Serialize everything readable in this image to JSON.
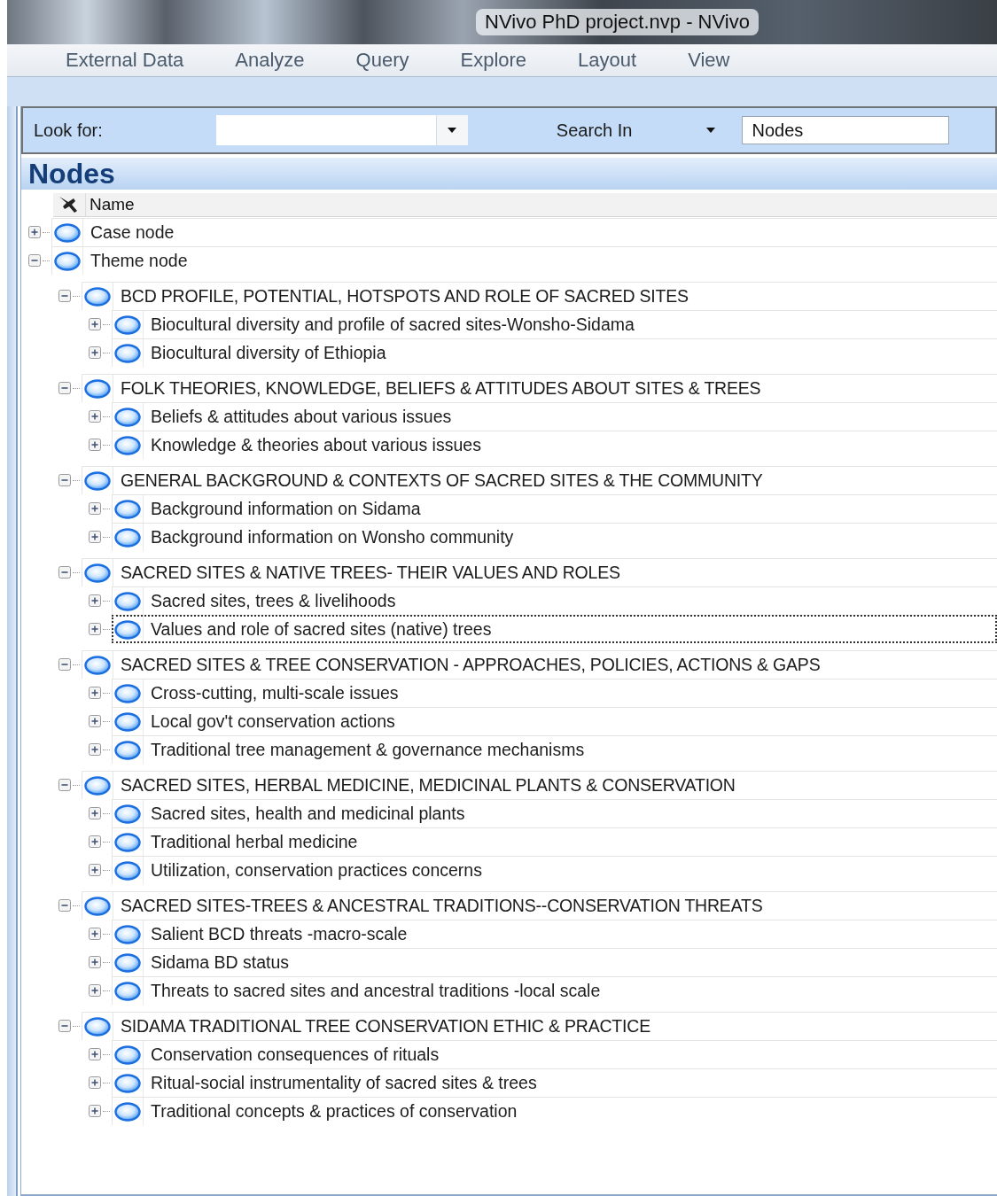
{
  "window": {
    "title": "NVivo PhD project.nvp - NVivo"
  },
  "menu": [
    {
      "label": "External Data"
    },
    {
      "label": "Analyze"
    },
    {
      "label": "Query"
    },
    {
      "label": "Explore"
    },
    {
      "label": "Layout"
    },
    {
      "label": "View"
    }
  ],
  "search": {
    "look_for_label": "Look for:",
    "search_in_label": "Search In",
    "scope": "Nodes"
  },
  "panel": {
    "title": "Nodes"
  },
  "columns": [
    "Name"
  ],
  "nodes": [
    {
      "name": "Case node",
      "expanded": false,
      "selected": false
    },
    {
      "name": "Theme node",
      "expanded": true,
      "selected": false,
      "children": [
        {
          "name": "BCD PROFILE, POTENTIAL, HOTSPOTS AND ROLE OF SACRED SITES",
          "expanded": true,
          "selected": false,
          "children": [
            {
              "name": "Biocultural diversity and profile of sacred sites-Wonsho-Sidama",
              "expanded": false,
              "selected": false
            },
            {
              "name": "Biocultural diversity of Ethiopia",
              "expanded": false,
              "selected": false
            }
          ]
        },
        {
          "name": "FOLK THEORIES, KNOWLEDGE, BELIEFS & ATTITUDES ABOUT SITES & TREES",
          "expanded": true,
          "selected": false,
          "children": [
            {
              "name": "Beliefs & attitudes about various issues",
              "expanded": false,
              "selected": false
            },
            {
              "name": "Knowledge & theories about various issues",
              "expanded": false,
              "selected": false
            }
          ]
        },
        {
          "name": "GENERAL BACKGROUND & CONTEXTS OF SACRED SITES & THE COMMUNITY",
          "expanded": true,
          "selected": false,
          "children": [
            {
              "name": "Background information on Sidama",
              "expanded": false,
              "selected": false
            },
            {
              "name": "Background information on Wonsho community",
              "expanded": false,
              "selected": false
            }
          ]
        },
        {
          "name": "SACRED SITES & NATIVE TREES- THEIR VALUES AND ROLES",
          "expanded": true,
          "selected": false,
          "children": [
            {
              "name": "Sacred sites, trees & livelihoods",
              "expanded": false,
              "selected": false
            },
            {
              "name": "Values and role of sacred sites (native) trees",
              "expanded": false,
              "selected": true
            }
          ]
        },
        {
          "name": "SACRED SITES & TREE CONSERVATION - APPROACHES, POLICIES, ACTIONS & GAPS",
          "expanded": true,
          "selected": false,
          "children": [
            {
              "name": "Cross-cutting, multi-scale issues",
              "expanded": false,
              "selected": false
            },
            {
              "name": "Local gov't conservation actions",
              "expanded": false,
              "selected": false
            },
            {
              "name": "Traditional tree management & governance mechanisms",
              "expanded": false,
              "selected": false
            }
          ]
        },
        {
          "name": "SACRED SITES, HERBAL MEDICINE, MEDICINAL PLANTS & CONSERVATION",
          "expanded": true,
          "selected": false,
          "children": [
            {
              "name": "Sacred sites, health and medicinal plants",
              "expanded": false,
              "selected": false
            },
            {
              "name": "Traditional herbal medicine",
              "expanded": false,
              "selected": false
            },
            {
              "name": "Utilization, conservation practices  concerns",
              "expanded": false,
              "selected": false
            }
          ]
        },
        {
          "name": "SACRED SITES-TREES & ANCESTRAL TRADITIONS--CONSERVATION THREATS",
          "expanded": true,
          "selected": false,
          "children": [
            {
              "name": "Salient  BCD threats -macro-scale",
              "expanded": false,
              "selected": false
            },
            {
              "name": "Sidama BD status",
              "expanded": false,
              "selected": false
            },
            {
              "name": "Threats to sacred sites and ancestral traditions -local scale",
              "expanded": false,
              "selected": false
            }
          ]
        },
        {
          "name": "SIDAMA TRADITIONAL TREE CONSERVATION ETHIC & PRACTICE",
          "expanded": true,
          "selected": false,
          "children": [
            {
              "name": "Conservation consequences of rituals",
              "expanded": false,
              "selected": false
            },
            {
              "name": "Ritual-social instrumentality of sacred sites & trees",
              "expanded": false,
              "selected": false
            },
            {
              "name": "Traditional concepts  & practices of conservation",
              "expanded": false,
              "selected": false
            }
          ]
        }
      ]
    }
  ]
}
